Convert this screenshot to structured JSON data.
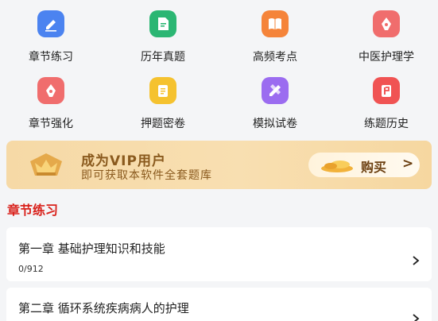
{
  "grid": [
    {
      "label": "章节练习",
      "icon": "edit-icon",
      "color": "#4b83f0"
    },
    {
      "label": "历年真题",
      "icon": "document-icon",
      "color": "#2bb673"
    },
    {
      "label": "高频考点",
      "icon": "book-icon",
      "color": "#f5843a"
    },
    {
      "label": "中医护理学",
      "icon": "pen-nib-icon",
      "color": "#f06d6d"
    },
    {
      "label": "章节强化",
      "icon": "pen-nib-icon",
      "color": "#f06d6d"
    },
    {
      "label": "押题密卷",
      "icon": "scroll-icon",
      "color": "#f5c22f"
    },
    {
      "label": "模拟试卷",
      "icon": "pencil-ruler-icon",
      "color": "#9b6cf0"
    },
    {
      "label": "练题历史",
      "icon": "history-card-icon",
      "color": "#f05353"
    }
  ],
  "vip": {
    "title": "成为VIP用户",
    "subtitle": "即可获取本软件全套题库",
    "button_label": "购买",
    "button_chevron": ">"
  },
  "section": {
    "title": "章节练习"
  },
  "chapters": [
    {
      "name": "第一章 基础护理知识和技能",
      "count": "0/912"
    },
    {
      "name": "第二章 循环系统疾病病人的护理",
      "count": ""
    }
  ],
  "colors": {
    "accent_red": "#d9221c",
    "vip_text": "#8a5a1e",
    "background": "#f4f5f7"
  }
}
